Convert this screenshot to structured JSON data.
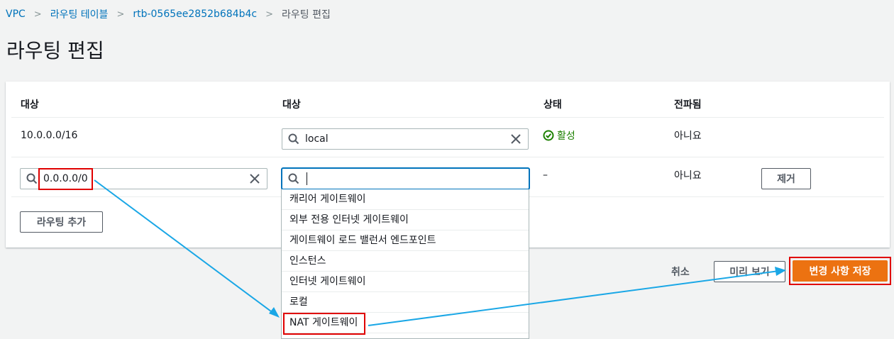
{
  "breadcrumb": {
    "items": [
      "VPC",
      "라우팅 테이블",
      "rtb-0565ee2852b684b4c"
    ],
    "current": "라우팅 편집"
  },
  "page_title": "라우팅 편집",
  "table": {
    "headers": [
      "대상",
      "대상",
      "상태",
      "전파됨"
    ],
    "rows": [
      {
        "destination": "10.0.0.0/16",
        "target": "local",
        "status": "활성",
        "propagated": "아니요"
      },
      {
        "destination": "0.0.0.0/0",
        "target": "",
        "status": "–",
        "propagated": "아니요",
        "remove_label": "제거"
      }
    ]
  },
  "add_route_label": "라우팅 추가",
  "dropdown": {
    "options": [
      "캐리어 게이트웨이",
      "외부 전용 인터넷 게이트웨이",
      "게이트웨이 로드 밸런서 엔드포인트",
      "인스턴스",
      "인터넷 게이트웨이",
      "로컬",
      "NAT 게이트웨이"
    ]
  },
  "footer": {
    "cancel_label": "취소",
    "preview_label": "미리 보기",
    "save_label": "변경 사항 저장"
  },
  "colors": {
    "accent": "#0073bb",
    "primary": "#ec7211",
    "success": "#1d8102",
    "annotation_box": "#e00000",
    "annotation_arrow": "#1aa7e6"
  }
}
